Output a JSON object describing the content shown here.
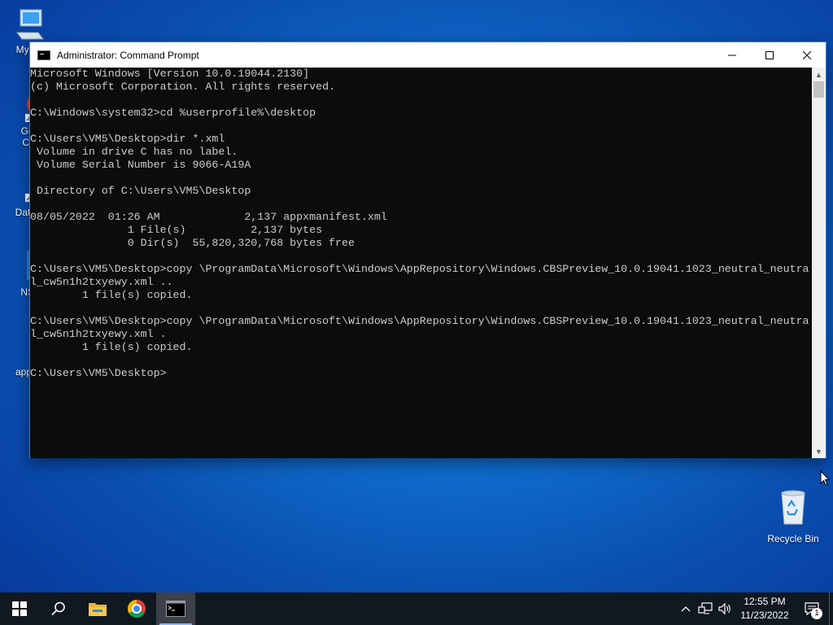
{
  "desktop": {
    "icons": [
      {
        "label": "My Co",
        "icon": "computer-icon"
      },
      {
        "label": "Goo\nChr",
        "icon": "chrome-shortcut-icon"
      },
      {
        "label": "DataW",
        "icon": "app-shortcut-icon"
      },
      {
        "label": "NSu",
        "icon": "gear-shortcut-icon"
      },
      {
        "label": "appxm",
        "icon": "xml-file-icon"
      }
    ],
    "recycle_bin": {
      "label": "Recycle Bin",
      "icon": "recycle-bin-icon"
    }
  },
  "window": {
    "title": "Administrator: Command Prompt",
    "console_lines": [
      "Microsoft Windows [Version 10.0.19044.2130]",
      "(c) Microsoft Corporation. All rights reserved.",
      "",
      "C:\\Windows\\system32>cd %userprofile%\\desktop",
      "",
      "C:\\Users\\VM5\\Desktop>dir *.xml",
      " Volume in drive C has no label.",
      " Volume Serial Number is 9066-A19A",
      "",
      " Directory of C:\\Users\\VM5\\Desktop",
      "",
      "08/05/2022  01:26 AM             2,137 appxmanifest.xml",
      "               1 File(s)          2,137 bytes",
      "               0 Dir(s)  55,820,320,768 bytes free",
      "",
      "C:\\Users\\VM5\\Desktop>copy \\ProgramData\\Microsoft\\Windows\\AppRepository\\Windows.CBSPreview_10.0.19041.1023_neutral_neutra",
      "l_cw5n1h2txyewy.xml ..",
      "        1 file(s) copied.",
      "",
      "C:\\Users\\VM5\\Desktop>copy \\ProgramData\\Microsoft\\Windows\\AppRepository\\Windows.CBSPreview_10.0.19041.1023_neutral_neutra",
      "l_cw5n1h2txyewy.xml .",
      "        1 file(s) copied.",
      "",
      "C:\\Users\\VM5\\Desktop>"
    ]
  },
  "taskbar": {
    "items": [
      {
        "name": "start-button",
        "icon": "windows-logo-icon"
      },
      {
        "name": "search-button",
        "icon": "search-icon"
      },
      {
        "name": "file-explorer-button",
        "icon": "folder-icon"
      },
      {
        "name": "chrome-button",
        "icon": "chrome-icon"
      },
      {
        "name": "command-prompt-button",
        "icon": "cmd-icon"
      }
    ],
    "clock": {
      "time": "12:55 PM",
      "date": "11/23/2022"
    },
    "notification_count": "1"
  },
  "colors": {
    "console_bg": "#0c0c0c",
    "console_text": "#cccccc",
    "taskbar_bg": "#101820",
    "desktop_blue": "#0f6fd0"
  }
}
